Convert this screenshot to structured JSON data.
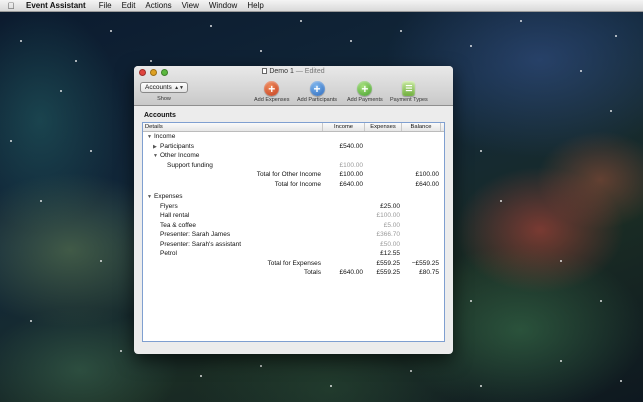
{
  "menubar": {
    "app_name": "Event Assistant",
    "items": [
      "File",
      "Edit",
      "Actions",
      "View",
      "Window",
      "Help"
    ]
  },
  "window": {
    "title": "Demo 1",
    "title_suffix": "— Edited",
    "show_popup": "Accounts",
    "show_label": "Show",
    "toolbar": {
      "add_expenses": "Add Expenses",
      "add_participants": "Add Participants",
      "add_payments": "Add Payments",
      "payment_types": "Payment Types"
    },
    "section_title": "Accounts",
    "columns": [
      "Details",
      "Income",
      "Expenses",
      "Balance"
    ],
    "rows": {
      "income": "Income",
      "participants": "Participants",
      "participants_income": "£540.00",
      "other_income": "Other Income",
      "support_funding": "Support funding",
      "support_funding_income": "£100.00",
      "total_other_label": "Total for Other Income",
      "total_other_income": "£100.00",
      "total_other_balance": "£100.00",
      "total_income_label": "Total for Income",
      "total_income_income": "£640.00",
      "total_income_balance": "£640.00",
      "expenses": "Expenses",
      "flyers": "Flyers",
      "flyers_exp": "£25.00",
      "hall_rental": "Hall rental",
      "hall_rental_exp": "£100.00",
      "tea_coffee": "Tea & coffee",
      "tea_coffee_exp": "£5.00",
      "presenter1": "Presenter: Sarah James",
      "presenter1_exp": "£366.70",
      "presenter2": "Presenter: Sarah's assistant",
      "presenter2_exp": "£50.00",
      "petrol": "Petrol",
      "petrol_exp": "£12.55",
      "total_exp_label": "Total for Expenses",
      "total_exp_exp": "£559.25",
      "total_exp_balance": "−£559.25",
      "totals_label": "Totals",
      "totals_income": "£640.00",
      "totals_exp": "£559.25",
      "totals_balance": "£80.75"
    }
  },
  "colors": {
    "selection_border": "#7f9fd0",
    "close": "#e0443e",
    "minimize": "#dea123",
    "zoom": "#5bb83f"
  }
}
